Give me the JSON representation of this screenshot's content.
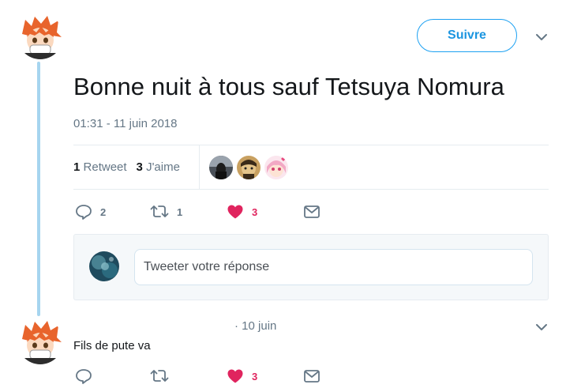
{
  "tweet": {
    "text": "Bonne nuit à tous sauf Tetsuya Nomura",
    "timestamp": "01:31 - 11 juin 2018",
    "follow_label": "Suivre",
    "retweet_count": "1",
    "retweet_label": "Retweet",
    "like_count": "3",
    "like_label": "J'aime",
    "actions": {
      "reply_count": "2",
      "retweet_count": "1",
      "like_count": "3"
    }
  },
  "reply_composer": {
    "placeholder": "Tweeter votre réponse"
  },
  "reply": {
    "date": "· 10 juin",
    "text": "Fils de pute va",
    "actions": {
      "like_count": "3"
    }
  },
  "colors": {
    "accent": "#1da1f2",
    "like": "#e0245e",
    "muted": "#657786",
    "thread_line": "#a6d5ef"
  },
  "icons": [
    "chevron-down-icon",
    "reply-icon",
    "retweet-icon",
    "heart-icon",
    "message-icon"
  ]
}
